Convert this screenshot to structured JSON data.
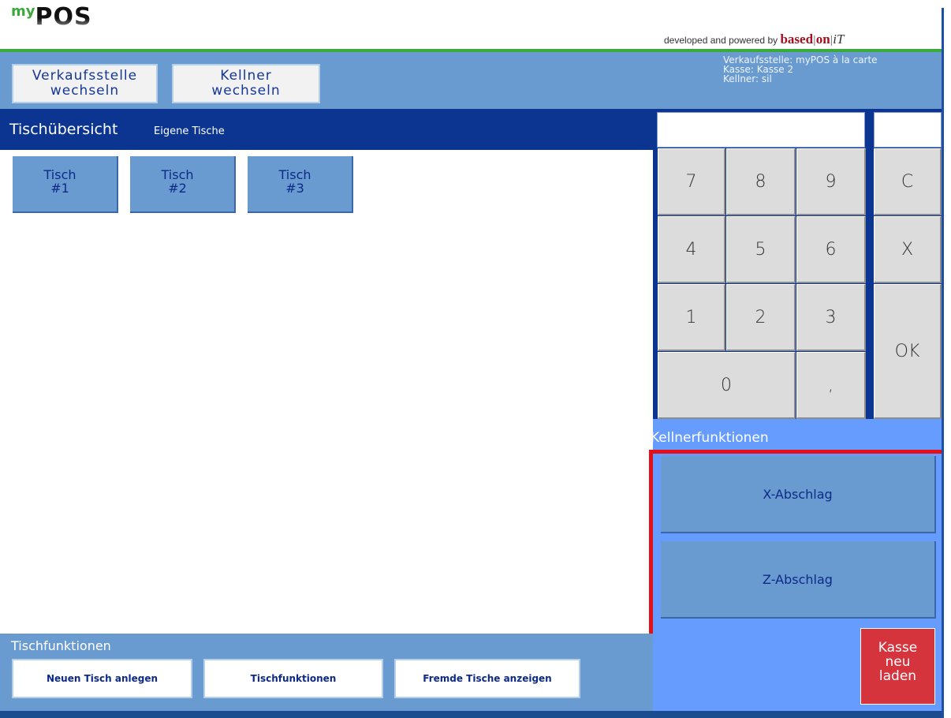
{
  "header": {
    "logo_my": "my",
    "logo_pos": "POS",
    "powered_prefix": "developed and powered by",
    "powered_based": "based",
    "powered_on": "on",
    "powered_it": "iT"
  },
  "topbar": {
    "verkaufsstelle_line1": "Verkaufsstelle",
    "verkaufsstelle_line2": "wechseln",
    "kellner_line1": "Kellner",
    "kellner_line2": "wechseln",
    "info_verkaufsstelle": "Verkaufsstelle: myPOS à la carte",
    "info_kasse": "Kasse: Kasse 2",
    "info_kellner": "Kellner: sil"
  },
  "overview": {
    "title": "Tischübersicht",
    "subtitle": "Eigene Tische",
    "tables": [
      {
        "line1": "Tisch",
        "line2": "#1"
      },
      {
        "line1": "Tisch",
        "line2": "#2"
      },
      {
        "line1": "Tisch",
        "line2": "#3"
      }
    ]
  },
  "numpad": {
    "display_value": "",
    "display_side_value": "",
    "keys": {
      "k7": "7",
      "k8": "8",
      "k9": "9",
      "clear": "C",
      "k4": "4",
      "k5": "5",
      "k6": "6",
      "x": "X",
      "k1": "1",
      "k2": "2",
      "k3": "3",
      "ok": "OK",
      "k0": "0",
      "comma": ","
    }
  },
  "kellnerfunktionen": {
    "title": "Kellnerfunktionen",
    "x_abschlag": "X-Abschlag",
    "z_abschlag": "Z-Abschlag",
    "kasse_line1": "Kasse",
    "kasse_line2": "neu",
    "kasse_line3": "laden"
  },
  "tischfunktionen": {
    "title": "Tischfunktionen",
    "neuer_tisch": "Neuen Tisch anlegen",
    "funktionen": "Tischfunktionen",
    "fremde": "Fremde Tische anzeigen"
  },
  "colors": {
    "accent_blue": "#0b3590",
    "panel_blue": "#6a9bd0",
    "kellner_blue": "#679cff",
    "highlight_red": "#e3101a",
    "kasse_red": "#d6343d",
    "logo_green": "#3aa83a"
  }
}
